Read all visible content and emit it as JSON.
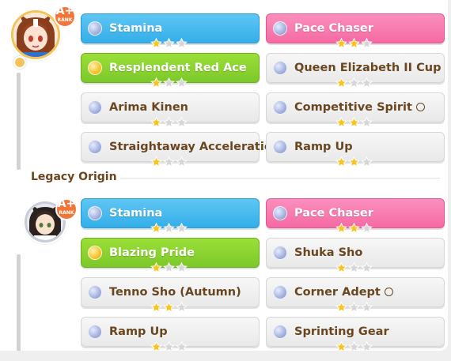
{
  "parents": [
    {
      "rank": "A+",
      "rank_word": "RANK",
      "factors": [
        {
          "label": "Stamina",
          "kind": "blue",
          "stars": 1,
          "marker": false
        },
        {
          "label": "Pace Chaser",
          "kind": "pink",
          "stars": 2,
          "marker": false
        },
        {
          "label": "Resplendent Red Ace",
          "kind": "green",
          "stars": 1,
          "marker": false
        },
        {
          "label": "Queen Elizabeth II Cup",
          "kind": "white",
          "stars": 1,
          "marker": false
        },
        {
          "label": "Arima Kinen",
          "kind": "white",
          "stars": 1,
          "marker": false
        },
        {
          "label": "Competitive Spirit",
          "kind": "white",
          "stars": 2,
          "marker": true
        },
        {
          "label": "Straightaway Acceleration",
          "kind": "white",
          "stars": 1,
          "marker": false
        },
        {
          "label": "Ramp Up",
          "kind": "white",
          "stars": 2,
          "marker": false
        }
      ]
    },
    {
      "rank": "A+",
      "rank_word": "RANK",
      "factors": [
        {
          "label": "Stamina",
          "kind": "blue",
          "stars": 1,
          "marker": false
        },
        {
          "label": "Pace Chaser",
          "kind": "pink",
          "stars": 2,
          "marker": false
        },
        {
          "label": "Blazing Pride",
          "kind": "green",
          "stars": 1,
          "marker": false
        },
        {
          "label": "Shuka Sho",
          "kind": "white",
          "stars": 1,
          "marker": false
        },
        {
          "label": "Tenno Sho (Autumn)",
          "kind": "white",
          "stars": 2,
          "marker": false
        },
        {
          "label": "Corner Adept",
          "kind": "white",
          "stars": 1,
          "marker": true
        },
        {
          "label": "Ramp Up",
          "kind": "white",
          "stars": 1,
          "marker": false
        },
        {
          "label": "Sprinting Gear",
          "kind": "white",
          "stars": 1,
          "marker": false
        }
      ]
    }
  ],
  "section_label": "Legacy Origin",
  "max_stars": 3,
  "colors": {
    "blue": "#34aee8",
    "pink": "#f56aa4",
    "green": "#7cc82a",
    "white_text": "#6a4620",
    "star_on": "#f7c51e",
    "star_off": "#d6d6d6"
  }
}
